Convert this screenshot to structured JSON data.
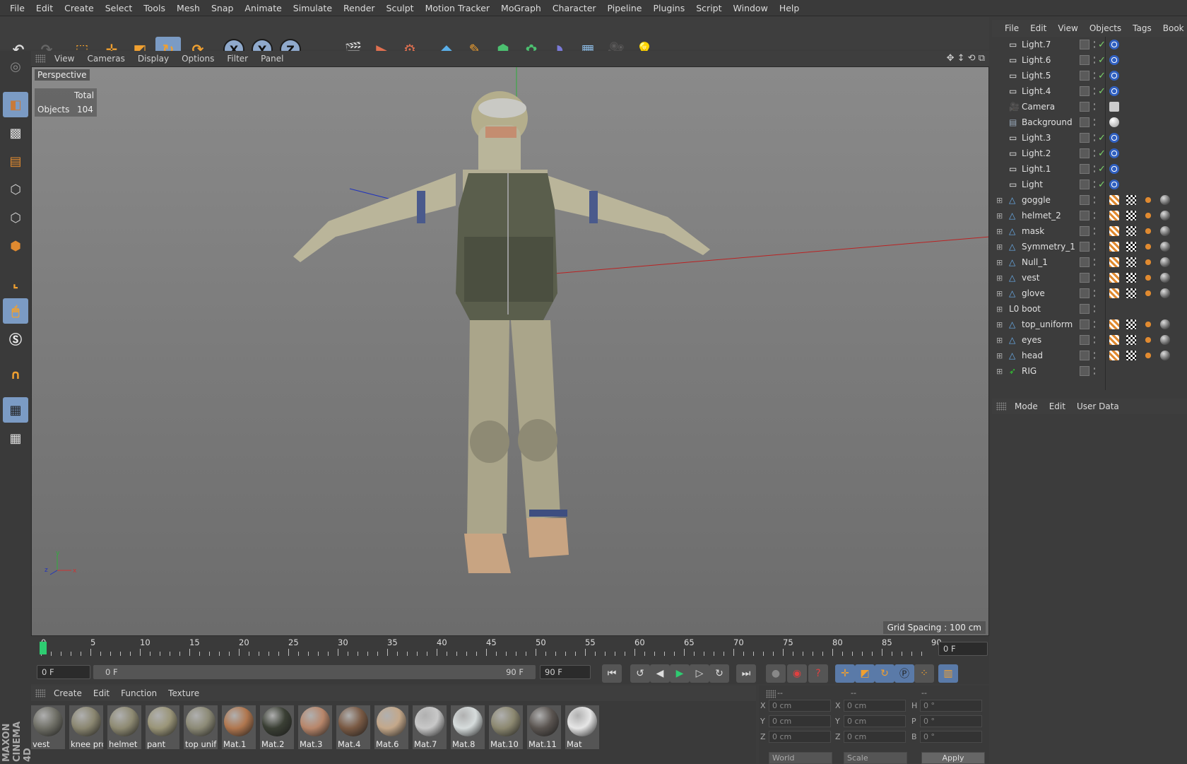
{
  "menu": [
    "File",
    "Edit",
    "Create",
    "Select",
    "Tools",
    "Mesh",
    "Snap",
    "Animate",
    "Simulate",
    "Render",
    "Sculpt",
    "Motion Tracker",
    "MoGraph",
    "Character",
    "Pipeline",
    "Plugins",
    "Script",
    "Window",
    "Help"
  ],
  "toolbar_icons": [
    "undo-icon",
    "redo-icon",
    "live-selection-icon",
    "move-icon",
    "scale-icon",
    "rotate-icon",
    "recent-tool-icon",
    "x-axis-icon",
    "y-axis-icon",
    "z-axis-icon",
    "coordinate-system-icon",
    "render-view-icon",
    "render-picture-viewer-icon",
    "edit-render-settings-icon",
    "cube-icon",
    "pen-icon",
    "subdivision-icon",
    "mograph-cloner-icon",
    "deformer-icon",
    "floor-icon",
    "camera-icon",
    "light-icon"
  ],
  "axis_labels": {
    "x": "X",
    "y": "Y",
    "z": "Z"
  },
  "viewport": {
    "menu": [
      "View",
      "Cameras",
      "Display",
      "Options",
      "Filter",
      "Panel"
    ],
    "camera_label": "Perspective",
    "stats": {
      "header": "Total",
      "row_label": "Objects",
      "row_value": "104"
    },
    "grid_spacing": "Grid Spacing : 100 cm",
    "axis_gizmo": {
      "x": "x",
      "y": "y",
      "z": "z"
    }
  },
  "timeline": {
    "ticks": [
      "0",
      "5",
      "10",
      "15",
      "20",
      "25",
      "30",
      "35",
      "40",
      "45",
      "50",
      "55",
      "60",
      "65",
      "70",
      "75",
      "80",
      "85",
      "90"
    ],
    "current_frame": "0 F"
  },
  "transport": {
    "start_field": "0 F",
    "range_start": "0 F",
    "range_end": "90 F",
    "end_field": "90 F"
  },
  "material_manager": {
    "menu": [
      "Create",
      "Edit",
      "Function",
      "Texture"
    ],
    "materials": [
      {
        "name": "vest",
        "color": "#6f6f66"
      },
      {
        "name": "knee pro",
        "color": "#8a8670"
      },
      {
        "name": "helmet",
        "color": "#8e8a72"
      },
      {
        "name": "pant",
        "color": "#9a9578"
      },
      {
        "name": "top unif",
        "color": "#8c8a76"
      },
      {
        "name": "Mat.1",
        "color": "#b0764e"
      },
      {
        "name": "Mat.2",
        "color": "#3a3f34"
      },
      {
        "name": "Mat.3",
        "color": "#b8866a"
      },
      {
        "name": "Mat.4",
        "color": "#7a5a44"
      },
      {
        "name": "Mat.6",
        "color": "#c4a88a"
      },
      {
        "name": "Mat.7",
        "color": "#c8c8c8"
      },
      {
        "name": "Mat.8",
        "color": "#d6dcdc"
      },
      {
        "name": "Mat.10",
        "color": "#8c8870"
      },
      {
        "name": "Mat.11",
        "color": "#5a5450"
      },
      {
        "name": "Mat",
        "color": "#e6e6e6"
      }
    ]
  },
  "coordinates": {
    "headers": [
      "--",
      "--",
      "--"
    ],
    "rows": [
      {
        "a_label": "X",
        "a": "0 cm",
        "b_label": "X",
        "b": "0 cm",
        "c_label": "H",
        "c": "0 °"
      },
      {
        "a_label": "Y",
        "a": "0 cm",
        "b_label": "Y",
        "b": "0 cm",
        "c_label": "P",
        "c": "0 °"
      },
      {
        "a_label": "Z",
        "a": "0 cm",
        "b_label": "Z",
        "b": "0 cm",
        "c_label": "B",
        "c": "0 °"
      }
    ],
    "mode_select": "World",
    "scale_select": "Scale",
    "apply": "Apply"
  },
  "object_manager": {
    "menu": [
      "File",
      "Edit",
      "View",
      "Objects",
      "Tags",
      "Book"
    ],
    "objects": [
      {
        "name": "Light.7",
        "icon": "light",
        "check": "✓",
        "tags": [
          "target"
        ]
      },
      {
        "name": "Light.6",
        "icon": "light",
        "check": "✓",
        "tags": [
          "target"
        ]
      },
      {
        "name": "Light.5",
        "icon": "light",
        "check": "✓",
        "tags": [
          "target"
        ]
      },
      {
        "name": "Light.4",
        "icon": "light",
        "check": "✓",
        "tags": [
          "target"
        ]
      },
      {
        "name": "Camera",
        "icon": "camera",
        "check": "",
        "tags": [
          "protection"
        ]
      },
      {
        "name": "Background",
        "icon": "background",
        "check": "",
        "tags": [
          "material"
        ]
      },
      {
        "name": "Light.3",
        "icon": "light",
        "check": "✓",
        "tags": [
          "target"
        ]
      },
      {
        "name": "Light.2",
        "icon": "light",
        "check": "✓",
        "tags": [
          "target"
        ]
      },
      {
        "name": "Light.1",
        "icon": "light",
        "check": "✓",
        "tags": [
          "target"
        ]
      },
      {
        "name": "Light",
        "icon": "light",
        "check": "✓",
        "tags": [
          "target"
        ]
      },
      {
        "name": "goggle",
        "icon": "poly",
        "check": "",
        "tags": [
          "uv",
          "uv2",
          "weight",
          "mat"
        ]
      },
      {
        "name": "helmet_2",
        "icon": "poly",
        "check": "",
        "tags": [
          "uv",
          "uv2",
          "weight",
          "mat"
        ]
      },
      {
        "name": "mask",
        "icon": "poly",
        "check": "",
        "tags": [
          "uv",
          "uv2",
          "weight",
          "mat"
        ]
      },
      {
        "name": "Symmetry_1",
        "icon": "poly",
        "check": "",
        "tags": [
          "uv",
          "uv2",
          "weight",
          "mat"
        ]
      },
      {
        "name": "Null_1",
        "icon": "poly",
        "check": "",
        "tags": [
          "uv",
          "uv2",
          "weight",
          "mat"
        ]
      },
      {
        "name": "vest",
        "icon": "poly",
        "check": "",
        "tags": [
          "uv",
          "uv2",
          "weight",
          "mat"
        ]
      },
      {
        "name": "glove",
        "icon": "poly",
        "check": "",
        "tags": [
          "uv",
          "uv2",
          "weight",
          "mat"
        ]
      },
      {
        "name": "boot",
        "icon": "null",
        "check": "",
        "tags": []
      },
      {
        "name": "top_uniform",
        "icon": "poly",
        "check": "",
        "tags": [
          "uv",
          "uv2",
          "weight",
          "mat"
        ]
      },
      {
        "name": "eyes",
        "icon": "poly",
        "check": "",
        "tags": [
          "uv",
          "uv2",
          "weight",
          "mat"
        ]
      },
      {
        "name": "head",
        "icon": "poly",
        "check": "",
        "tags": [
          "uv",
          "uv2",
          "weight",
          "mat"
        ]
      },
      {
        "name": "RIG",
        "icon": "joint",
        "check": "",
        "tags": []
      }
    ]
  },
  "attribute_manager": {
    "menu": [
      "Mode",
      "Edit",
      "User Data"
    ]
  },
  "brand": "MAXON CINEMA 4D",
  "colors": {
    "selected": "#7b9bc4",
    "check": "#7cd46a",
    "timeline_marker": "#2ecc71"
  }
}
